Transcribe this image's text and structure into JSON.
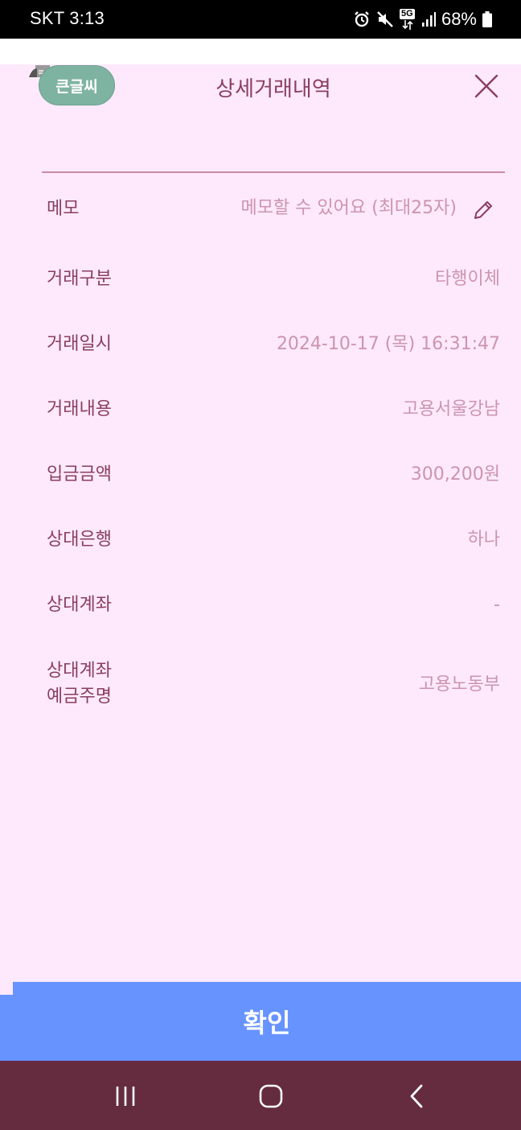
{
  "status_bar": {
    "carrier_time": "SKT 3:13",
    "network": "5G",
    "battery": "68%",
    "icons": [
      "alarm-icon",
      "mute-icon",
      "5g-data-icon",
      "signal-icon",
      "battery-icon"
    ]
  },
  "header": {
    "big_font_label": "큰글씨",
    "title": "상세거래내역",
    "close_icon": "close-icon"
  },
  "memo": {
    "label": "메모",
    "placeholder": "메모할 수 있어요 (최대25자)",
    "edit_icon": "pencil-icon"
  },
  "details": [
    {
      "label": "거래구분",
      "value": "타행이체"
    },
    {
      "label": "거래일시",
      "value": "2024-10-17 (목) 16:31:47"
    },
    {
      "label": "거래내용",
      "value": "고용서울강남"
    },
    {
      "label": "입금금액",
      "value": "300,200원"
    },
    {
      "label": "상대은행",
      "value": "하나"
    },
    {
      "label": "상대계좌",
      "value": "-"
    },
    {
      "label_line1": "상대계좌",
      "label_line2": "예금주명",
      "value": "고용노동부"
    }
  ],
  "confirm_button": "확인",
  "nav_bar": {
    "recent_apps_icon": "recent-apps-icon",
    "home_icon": "home-icon",
    "back_icon": "back-icon"
  },
  "colors": {
    "background": "#fde9fb",
    "label_text": "#8a3e62",
    "value_text": "#cc94b0",
    "confirm_button": "#6693ff",
    "big_font_button": "#7fb3a1",
    "nav_bar": "#652b3e"
  }
}
